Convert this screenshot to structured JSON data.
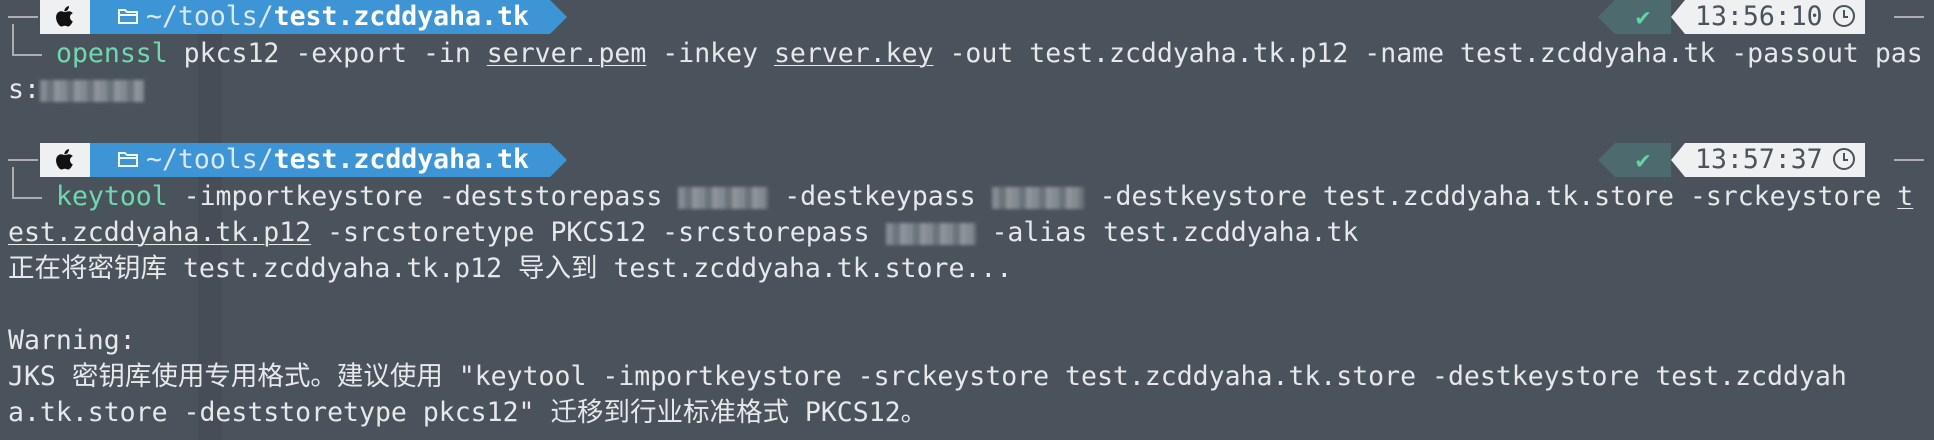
{
  "prompt1": {
    "path_prefix": "~/tools/",
    "path_dir": "test.zcddyaha.tk",
    "status": "✔",
    "time": "13:56:10"
  },
  "cmd1": {
    "name": "openssl",
    "a": " pkcs12 -export -in ",
    "in_file": "server.pem",
    "b": " -inkey ",
    "key_file": "server.key",
    "c": " -out test.zcddyaha.tk.p12 -name test.zcddyaha.tk -passout pas",
    "d": "s:"
  },
  "prompt2": {
    "path_prefix": "~/tools/",
    "path_dir": "test.zcddyaha.tk",
    "status": "✔",
    "time": "13:57:37"
  },
  "cmd2": {
    "name": "keytool",
    "a": " -importkeystore -deststorepass ",
    "b": " -destkeypass ",
    "c": " -destkeystore test.zcddyaha.tk.store -srckeystore ",
    "src_start": "t",
    "src_rest": "est.zcddyaha.tk.p12",
    "d": " -srcstoretype PKCS12 -srcstorepass ",
    "e": " -alias test.zcddyaha.tk"
  },
  "output": {
    "importing": "正在将密钥库 test.zcddyaha.tk.p12 导入到 test.zcddyaha.tk.store...",
    "warning_label": "Warning:",
    "warning_line1": "JKS 密钥库使用专用格式。建议使用 \"keytool -importkeystore -srckeystore test.zcddyaha.tk.store -destkeystore test.zcddyah",
    "warning_line2": "a.tk.store -deststoretype pkcs12\" 迁移到行业标准格式 PKCS12。"
  }
}
